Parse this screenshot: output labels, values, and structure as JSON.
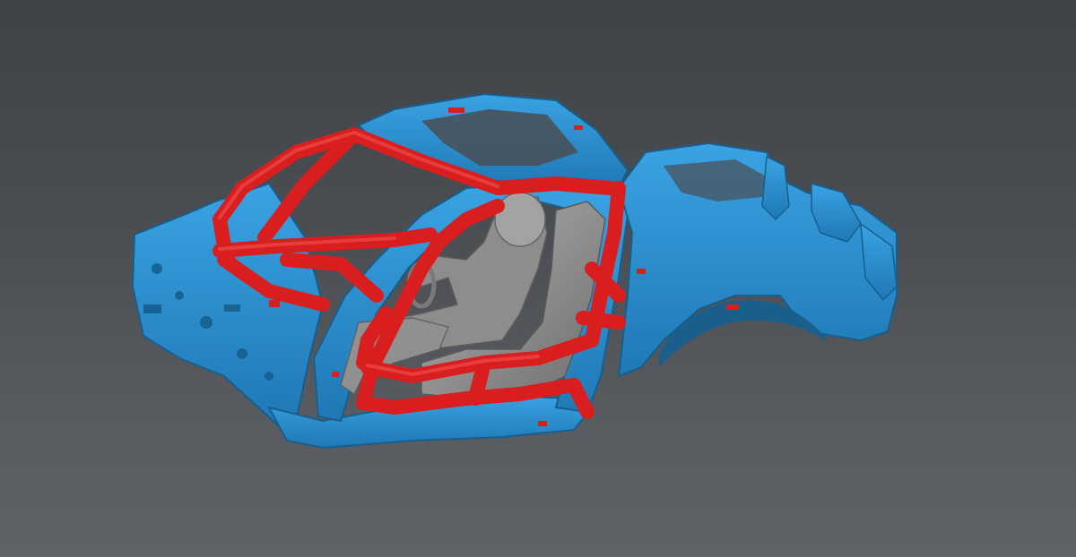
{
  "scene": {
    "subject": "3d-scan-car-body-with-roll-cage",
    "colors": {
      "background_top": "#3f4247",
      "background_bottom": "#5f6267",
      "body_shell": "#2a8fd0",
      "body_shell_shadow": "#1d6fa6",
      "roll_cage": "#d81e1e",
      "roll_cage_shadow": "#a01414",
      "seat_and_driver": "#9a9a9a",
      "seat_shadow": "#6f6f6f"
    }
  }
}
